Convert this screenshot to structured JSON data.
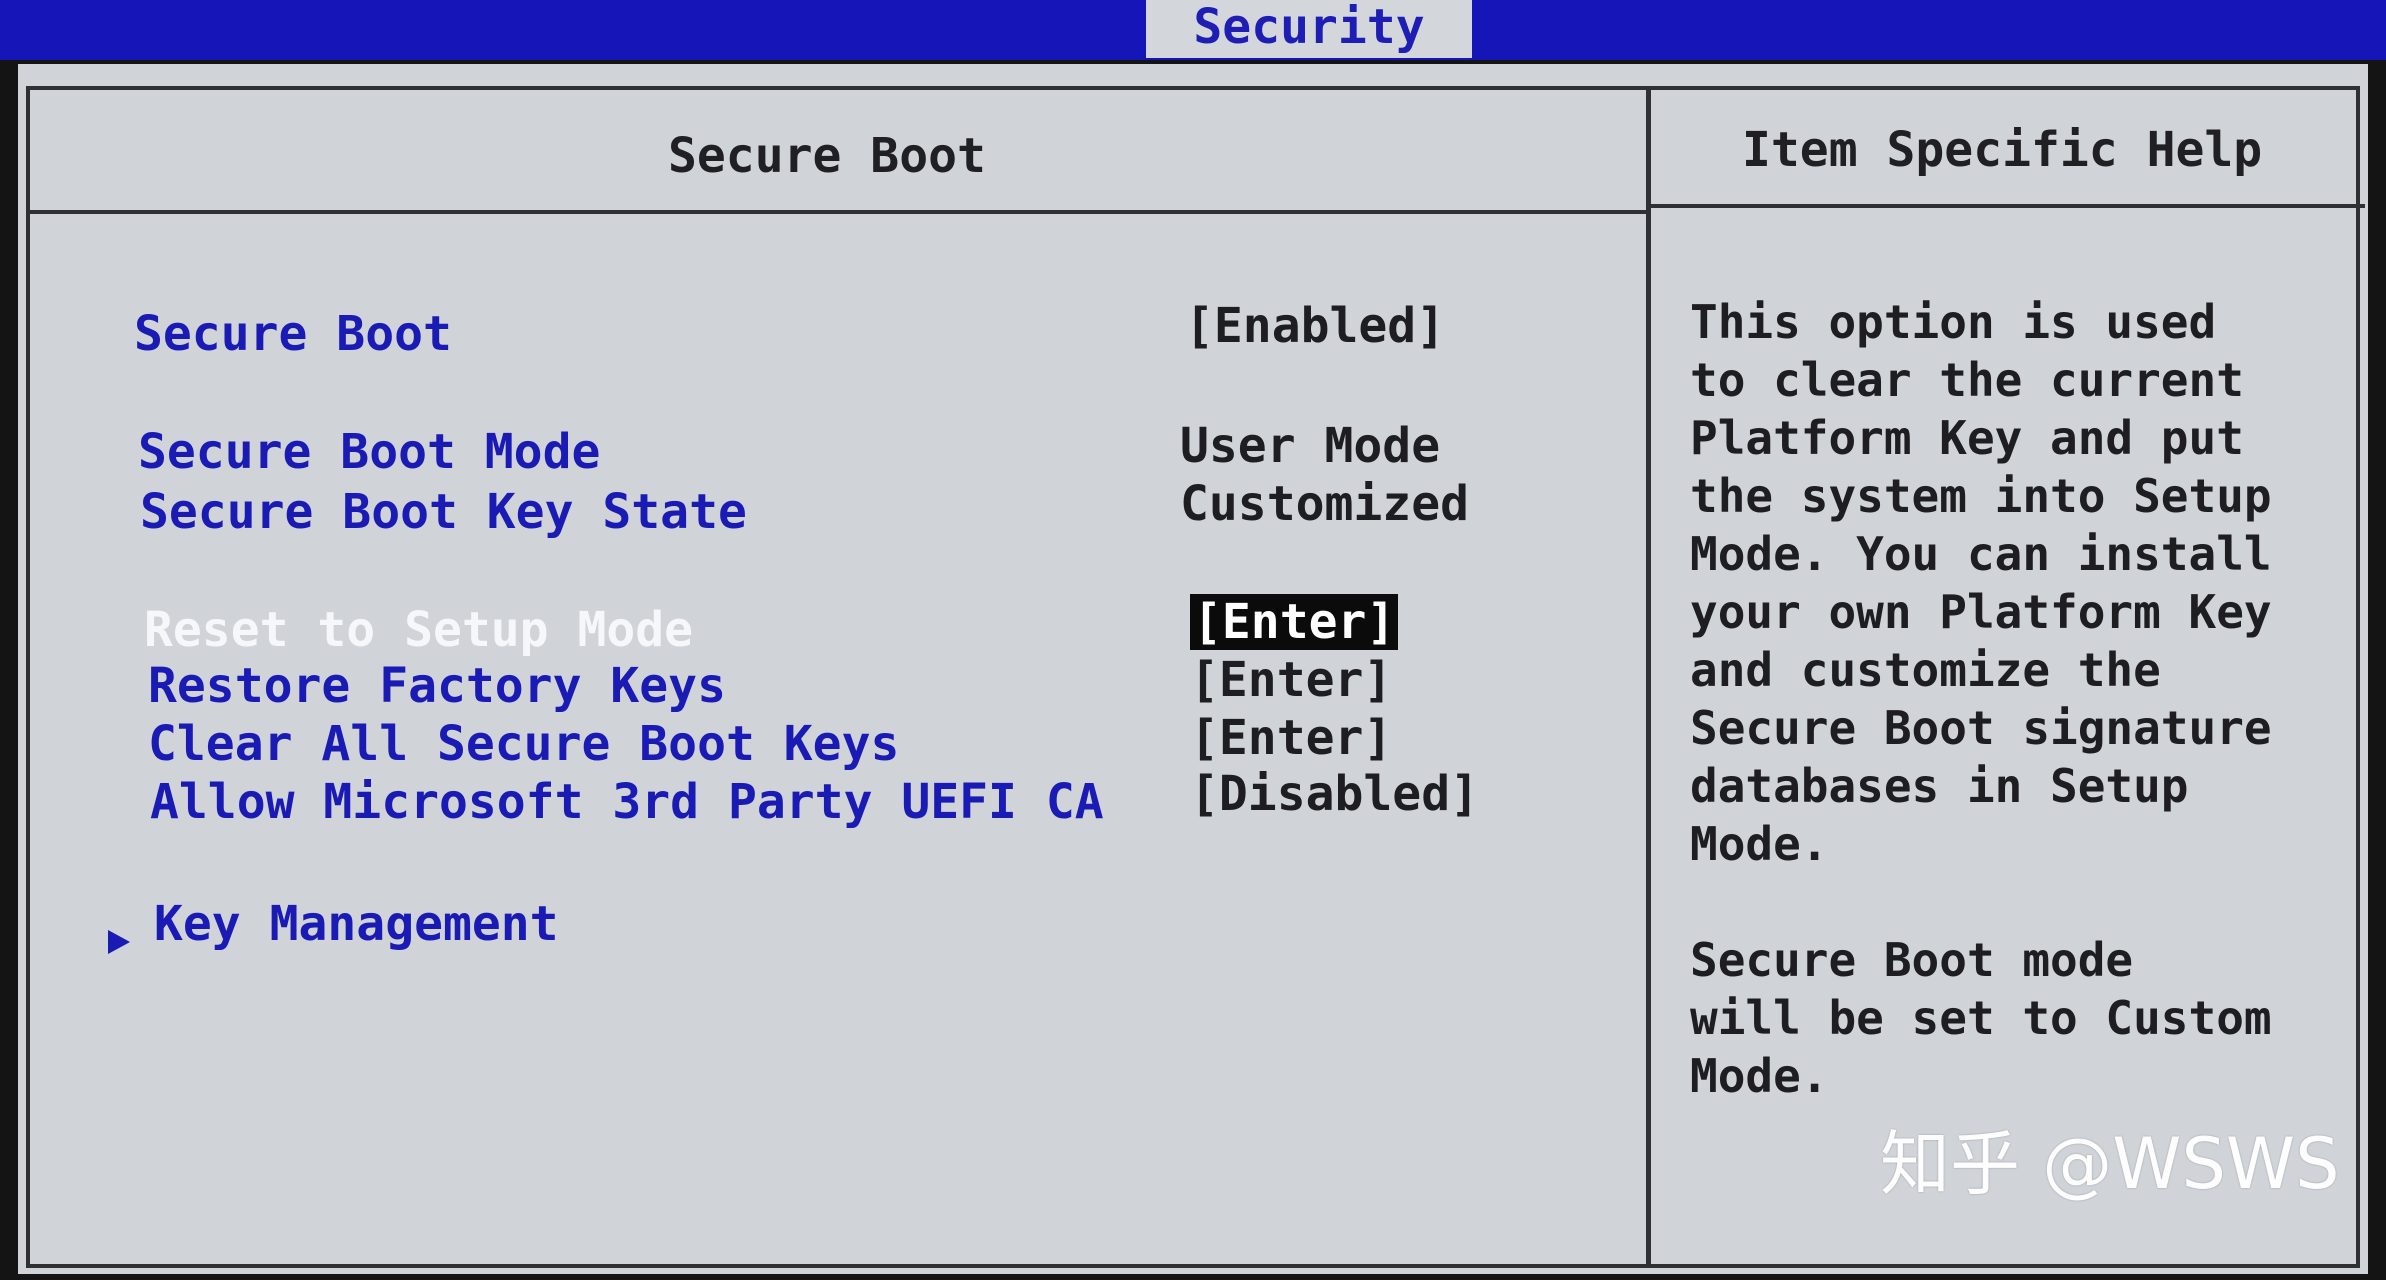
{
  "top_tab": "Security",
  "left_panel_title": "Secure Boot",
  "right_panel_title": "Item Specific Help",
  "menu_items": [
    {
      "label": "Secure Boot",
      "value": "[Enabled]"
    },
    {
      "label": "Secure Boot Mode",
      "value": "User Mode"
    },
    {
      "label": "Secure Boot Key State",
      "value": "Customized"
    },
    {
      "label": "Reset to Setup Mode",
      "value": "[Enter]"
    },
    {
      "label": "Restore Factory Keys",
      "value": "[Enter]"
    },
    {
      "label": "Clear All Secure Boot Keys",
      "value": "[Enter]"
    },
    {
      "label": "Allow Microsoft 3rd Party UEFI CA",
      "value": "[Disabled]"
    }
  ],
  "submenu": {
    "label": "Key Management"
  },
  "help_lines": [
    "This option is used",
    "to clear the current",
    "Platform Key and put",
    "the system into Setup",
    "Mode. You can install",
    "your own Platform Key",
    "and customize the",
    "Secure Boot signature",
    "databases in Setup",
    "Mode.",
    " Secure Boot mode",
    "will be set to Custom",
    "Mode."
  ],
  "watermark": "知乎 @WSWS",
  "colors": {
    "bar_blue": "#1616b8",
    "menu_blue": "#1a1ab4",
    "panel_gray": "#d0d3d8",
    "selected_text": "#f6f7fb"
  }
}
